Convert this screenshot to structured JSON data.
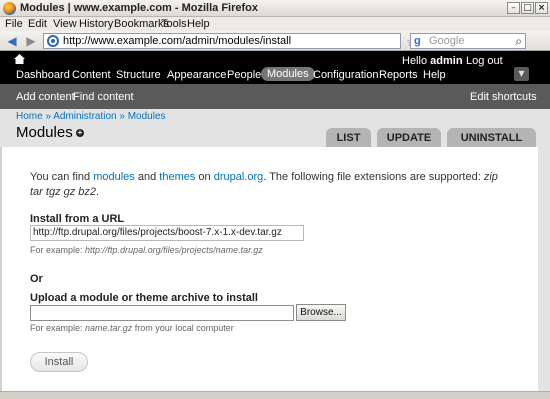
{
  "window": {
    "title": "Modules | www.example.com - Mozilla Firefox",
    "minimize_icon": "minimize-icon",
    "maximize_icon": "maximize-icon",
    "close_icon": "close-icon"
  },
  "menubar": {
    "items": [
      "File",
      "Edit",
      "View",
      "History",
      "Bookmarks",
      "Tools",
      "Help"
    ]
  },
  "navbar": {
    "url": "http://www.example.com/admin/modules/install",
    "search_placeholder": "Google"
  },
  "toolbar": {
    "greeting": "Hello",
    "username": "admin",
    "logout": "Log out",
    "items": [
      "Dashboard",
      "Content",
      "Structure",
      "Appearance",
      "People",
      "Modules",
      "Configuration",
      "Reports",
      "Help"
    ],
    "active_item": "Modules"
  },
  "shortcuts": {
    "add_content": "Add content",
    "find_content": "Find content",
    "edit_shortcuts": "Edit shortcuts"
  },
  "page": {
    "breadcrumb": "Home » Administration » Modules",
    "title": "Modules",
    "tabs": [
      "LIST",
      "UPDATE",
      "UNINSTALL"
    ]
  },
  "content": {
    "intro_prefix": "You can find",
    "modules_link": "modules",
    "and_text": "and",
    "themes_link": "themes",
    "on_text": "on",
    "drupal_link": "drupal.org",
    "intro_suffix": ". The following file extensions are supported:",
    "extensions": "zip tar tgz gz bz2",
    "period": ".",
    "install_url_label": "Install from a URL",
    "install_url_value": "http://ftp.drupal.org/files/projects/boost-7.x-1.x-dev.tar.gz",
    "url_example_prefix": "For example:",
    "url_example": "http://ftp.drupal.org/files/projects/name.tar.gz",
    "or_label": "Or",
    "upload_label": "Upload a module or theme archive to install",
    "browse_label": "Browse...",
    "file_example_prefix": "For example:",
    "file_example": "name.tar.gz",
    "file_example_suffix": "from your local computer",
    "install_button": "Install"
  }
}
